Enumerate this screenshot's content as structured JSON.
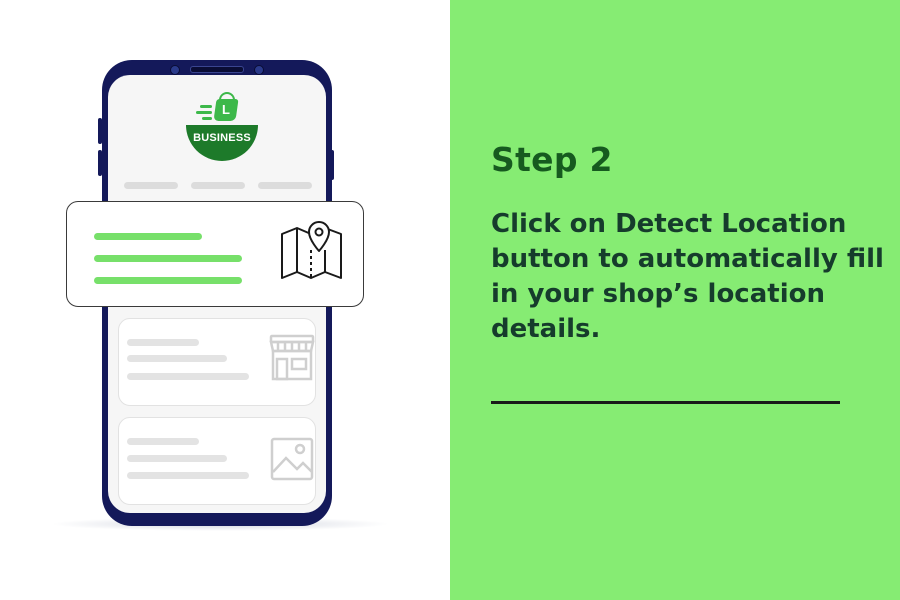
{
  "logo": {
    "badge_text": "BUSINESS",
    "bag_letter": "L"
  },
  "icons": {
    "map": "map-pin-icon",
    "store": "storefront-icon",
    "image": "image-icon",
    "bag": "shopping-bag-icon"
  },
  "colors": {
    "panel_green": "#86ec73",
    "heading_green": "#165a1f",
    "text_dark": "#163c2c",
    "phone_navy": "#14195a",
    "accent_green": "#77e06a"
  },
  "step": {
    "title": "Step 2",
    "description": "Click on Detect Location button to automatically fill in your shop’s location details."
  }
}
